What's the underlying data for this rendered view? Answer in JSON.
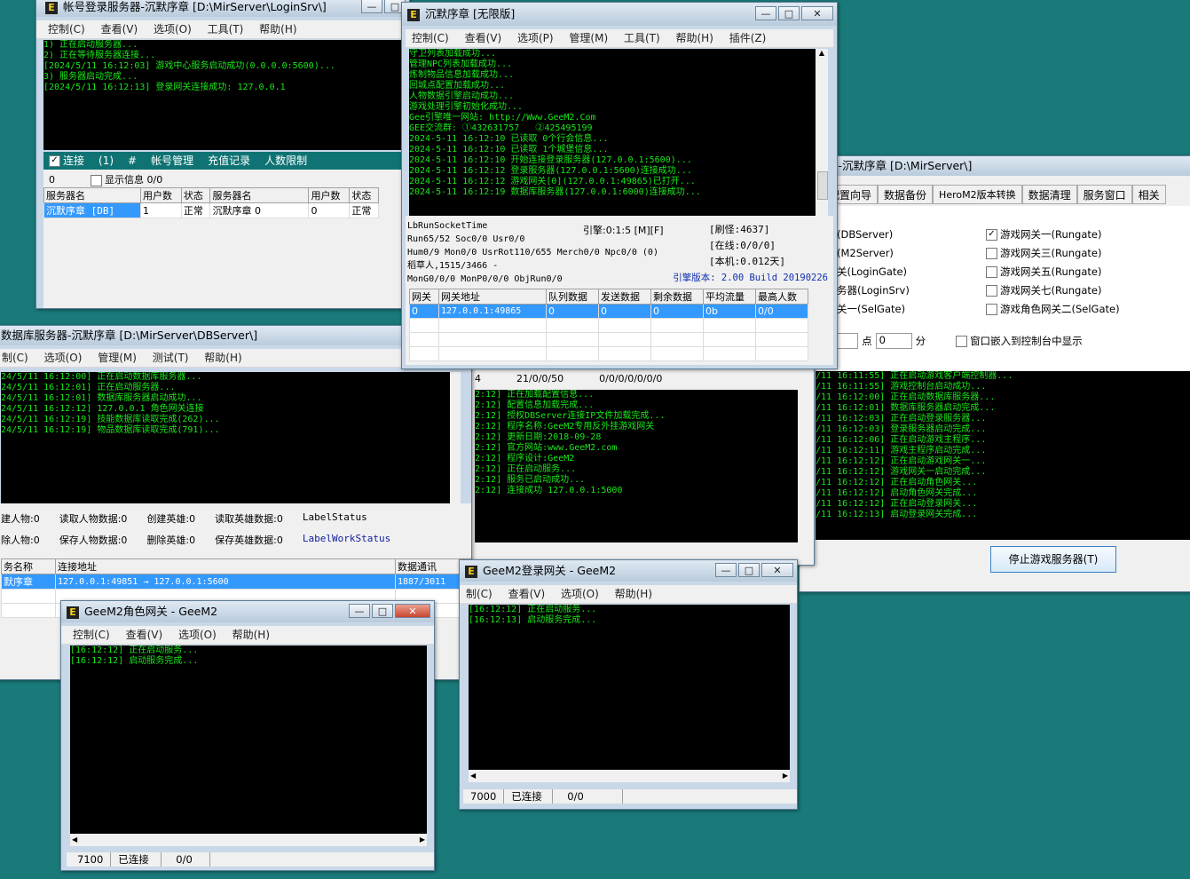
{
  "common_controls": {
    "minimize": "—",
    "maximize": "□",
    "close": "✕",
    "scroll_up": "▲",
    "scroll_down": "▼",
    "scroll_left": "◀",
    "scroll_right": "▶"
  },
  "login_server": {
    "title": "帐号登录服务器-沉默序章  [D:\\MirServer\\LoginSrv\\]",
    "menu": [
      "控制(C)",
      "查看(V)",
      "选项(O)",
      "工具(T)",
      "帮助(H)"
    ],
    "log": "1) 正在启动服务器...\n2) 正在等待服务器连接...\n[2024/5/11 16:12:03] 游戏中心服务启动成功(0.0.0.0:5600)...\n3) 服务器启动完成...\n[2024/5/11 16:12:13] 登录网关连接成功: 127.0.0.1",
    "toolbar": {
      "connect": "连接",
      "connect_count": "(1)",
      "hash": "#",
      "account_mgmt": "帐号管理",
      "recharge": "充值记录",
      "limit": "人数限制",
      "zero": "0",
      "show_info": "显示信息",
      "info_val": "0/0"
    },
    "columns": [
      "服务器名",
      "用户数",
      "状态",
      "服务器名",
      "用户数",
      "状态"
    ],
    "row": [
      "沉默序章 [DB]",
      "1",
      "正常",
      "沉默序章 0",
      "0",
      "正常"
    ]
  },
  "m2": {
    "title": "沉默序章 [无限版]",
    "menu": [
      "控制(C)",
      "查看(V)",
      "选项(P)",
      "管理(M)",
      "工具(T)",
      "帮助(H)",
      "插件(Z)"
    ],
    "log": "守卫列表加载成功...\n管理NPC列表加载成功...\n炼制物品信息加载成功...\n回城点配置加载成功...\n人物数据引擎启动成功...\n游戏处理引擎初始化成功...\nGee引擎唯一网站: http://Www.GeeM2.Com\nGEE交流群: ①432631757   ②425495199\n2024-5-11 16:12:10 已读取 0个行会信息...\n2024-5-11 16:12:10 已读取 1个城堡信息...\n2024-5-11 16:12:10 开始连接登录服务器(127.0.0.1:5600)...\n2024-5-11 16:12:12 登录服务器(127.0.0.1:5600)连接成功...\n2024-5-11 16:12:12 游戏网关[0](127.0.0.1:49865)已打开...\n2024-5-11 16:12:19 数据库服务器(127.0.0.1:6000)连接成功...",
    "info": {
      "l1": "LbRunSocketTime",
      "l2": "Run65/52 Soc0/0 Usr0/0",
      "l3": "Hum0/9 Mon0/0 UsrRot110/655 Merch0/0 Npc0/0 (0)",
      "l4": "稻草人,1515/3466 -",
      "l5": "MonG0/0/0 MonP0/0/0 ObjRun0/0",
      "engine": "引擎:0:1:5 [M][F]",
      "refresh": "[刷怪:4637]",
      "online": "[在线:0/0/0]",
      "local": "[本机:0.012天]",
      "version": "引擎版本: 2.00 Build 20190226"
    },
    "columns": [
      "网关",
      "网关地址",
      "队列数据",
      "发送数据",
      "剩余数据",
      "平均流量",
      "最高人数"
    ],
    "row": [
      "0",
      "127.0.0.1:49865",
      "0",
      "0",
      "0",
      "0b",
      "0/0"
    ]
  },
  "console": {
    "title": "控制台-沉默序章 [D:\\MirServer\\]",
    "tabs": [
      "号",
      "配置向导",
      "数据备份",
      "HeroM2版本转换",
      "数据清理",
      "服务窗口",
      "相关"
    ],
    "left_items": [
      "(DBServer)",
      "(M2Server)",
      "关(LoginGate)",
      "务器(LoginSrv)",
      "关一(SelGate)"
    ],
    "right_items": [
      "游戏网关一(Rungate)",
      "游戏网关三(Rungate)",
      "游戏网关五(Rungate)",
      "游戏网关七(Rungate)",
      "游戏角色网关二(SelGate)"
    ],
    "timer": {
      "prefix": "n:",
      "hour": "0",
      "point": "点",
      "minute": "0",
      "minute_label": "分"
    },
    "embed": "窗口嵌入到控制台中显示",
    "log": "/11 16:11:55] 正在启动游戏客户端控制器...\n/11 16:11:55] 游戏控制台启动成功...\n/11 16:12:00] 正在启动数据库服务器...\n/11 16:12:01] 数据库服务器启动完成...\n/11 16:12:03] 正在启动登录服务器...\n/11 16:12:03] 登录服务器启动完成...\n/11 16:12:06] 正在启动游戏主程序...\n/11 16:12:11] 游戏主程序启动完成...\n/11 16:12:12] 正在启动游戏网关一...\n/11 16:12:12] 游戏网关一启动完成...\n/11 16:12:12] 正在启动角色网关...\n/11 16:12:12] 启动角色网关完成...\n/11 16:12:12] 正在启动登录网关...\n/11 16:12:13] 启动登录网关完成...",
    "stop_button": "停止游戏服务器(T)"
  },
  "dbserver": {
    "title": "数据库服务器-沉默序章  [D:\\MirServer\\DBServer\\]",
    "menu": [
      "制(C)",
      "选项(O)",
      "管理(M)",
      "测试(T)",
      "帮助(H)"
    ],
    "log": "24/5/11 16:12:00] 正在启动数据库服务器...\n24/5/11 16:12:01] 正在启动服务器...\n24/5/11 16:12:01] 数据库服务器启动成功...\n24/5/11 16:12:12] 127.0.0.1 角色网关连接\n24/5/11 16:12:19] 技能数据库读取完成(262)...\n24/5/11 16:12:19] 物品数据库读取完成(791)...",
    "stats1": [
      "建人物:0",
      "读取人物数据:0",
      "创建英雄:0",
      "读取英雄数据:0",
      "LabelStatus"
    ],
    "stats2": [
      "除人物:0",
      "保存人物数据:0",
      "删除英雄:0",
      "保存英雄数据:0",
      "LabelWorkStatus"
    ],
    "columns": [
      "务名称",
      "连接地址",
      "数据通讯"
    ],
    "row": [
      "默序章",
      "127.0.0.1:49851 → 127.0.0.1:5600",
      "1887/3011"
    ]
  },
  "rungate": {
    "info": [
      "4",
      "21/0/0/50",
      "0/0/0/0/0/0/0"
    ],
    "log": "2:12] 正在加载配置信息...\n2:12] 配置信息加载完成...\n2:12] 授权DBServer连接IP文件加载完成...\n2:12] 程序名称:GeeM2专用反外挂游戏网关\n2:12] 更新日期:2018-09-28\n2:12] 官方网站:www.GeeM2.com\n2:12] 程序设计:GeeM2\n2:12] 正在启动服务...\n2:12] 服务已启动成功...\n2:12] 连接成功 127.0.0.1:5000"
  },
  "login_gate": {
    "title": "GeeM2登录网关 - GeeM2",
    "menu": [
      "制(C)",
      "查看(V)",
      "选项(O)",
      "帮助(H)"
    ],
    "log": "[16:12:12] 正在启动服务...\n[16:12:13] 启动服务完成...",
    "status": [
      "7000",
      "已连接",
      "0/0"
    ]
  },
  "role_gate": {
    "title": "GeeM2角色网关 - GeeM2",
    "menu": [
      "控制(C)",
      "查看(V)",
      "选项(O)",
      "帮助(H)"
    ],
    "log": "[16:12:12] 正在启动服务...\n[16:12:12] 启动服务完成...",
    "status": [
      "7100",
      "已连接",
      "0/0"
    ]
  }
}
